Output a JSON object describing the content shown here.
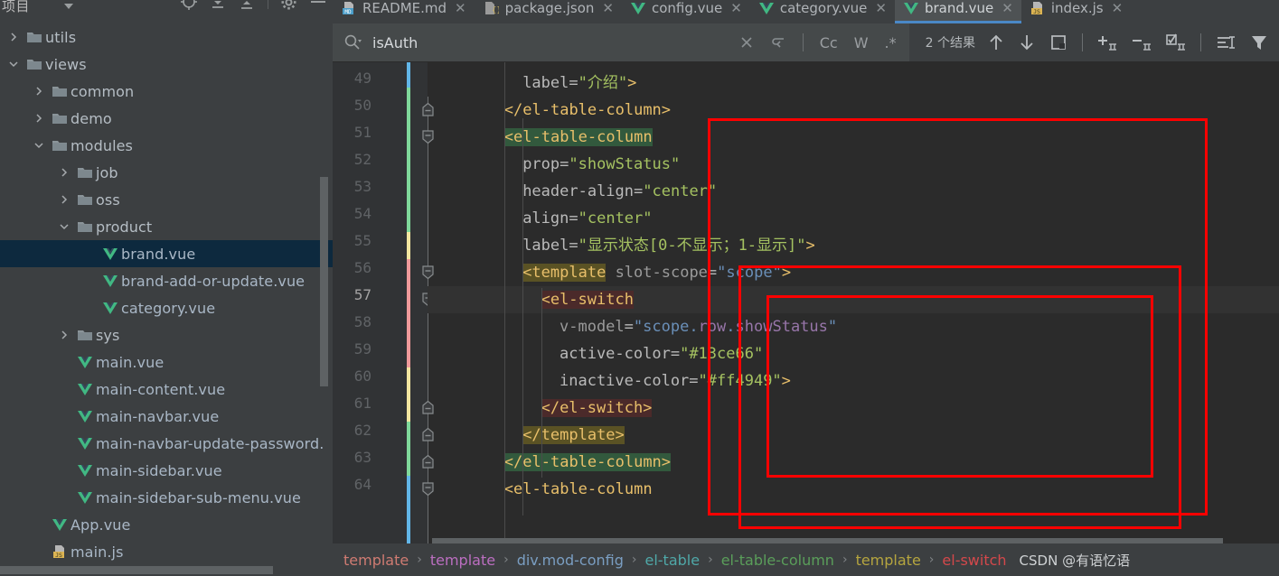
{
  "sidebar": {
    "title": "项目",
    "toolbar": [
      "locate-icon",
      "collapse-all-icon",
      "expand-icon",
      "settings-icon",
      "minimize-icon"
    ],
    "tree": [
      {
        "label": "utils",
        "type": "folder",
        "depth": 1,
        "state": "collapsed",
        "selected": false
      },
      {
        "label": "views",
        "type": "folder",
        "depth": 1,
        "state": "expanded",
        "selected": false
      },
      {
        "label": "common",
        "type": "folder",
        "depth": 2,
        "state": "collapsed",
        "selected": false
      },
      {
        "label": "demo",
        "type": "folder",
        "depth": 2,
        "state": "collapsed",
        "selected": false
      },
      {
        "label": "modules",
        "type": "folder",
        "depth": 2,
        "state": "expanded",
        "selected": false
      },
      {
        "label": "job",
        "type": "folder",
        "depth": 3,
        "state": "collapsed",
        "selected": false
      },
      {
        "label": "oss",
        "type": "folder",
        "depth": 3,
        "state": "collapsed",
        "selected": false
      },
      {
        "label": "product",
        "type": "folder",
        "depth": 3,
        "state": "expanded",
        "selected": false
      },
      {
        "label": "brand.vue",
        "type": "vue",
        "depth": 4,
        "state": "leaf",
        "selected": true
      },
      {
        "label": "brand-add-or-update.vue",
        "type": "vue",
        "depth": 4,
        "state": "leaf",
        "selected": false
      },
      {
        "label": "category.vue",
        "type": "vue",
        "depth": 4,
        "state": "leaf",
        "selected": false
      },
      {
        "label": "sys",
        "type": "folder",
        "depth": 3,
        "state": "collapsed",
        "selected": false
      },
      {
        "label": "main.vue",
        "type": "vue",
        "depth": 3,
        "state": "leaf",
        "selected": false
      },
      {
        "label": "main-content.vue",
        "type": "vue",
        "depth": 3,
        "state": "leaf",
        "selected": false
      },
      {
        "label": "main-navbar.vue",
        "type": "vue",
        "depth": 3,
        "state": "leaf",
        "selected": false
      },
      {
        "label": "main-navbar-update-password.",
        "type": "vue",
        "depth": 3,
        "state": "leaf",
        "selected": false
      },
      {
        "label": "main-sidebar.vue",
        "type": "vue",
        "depth": 3,
        "state": "leaf",
        "selected": false
      },
      {
        "label": "main-sidebar-sub-menu.vue",
        "type": "vue",
        "depth": 3,
        "state": "leaf",
        "selected": false
      },
      {
        "label": "App.vue",
        "type": "vue",
        "depth": 2,
        "state": "leaf",
        "selected": false
      },
      {
        "label": "main.js",
        "type": "js",
        "depth": 2,
        "state": "leaf",
        "selected": false
      }
    ]
  },
  "tabs": [
    {
      "label": "README.md",
      "icon": "markdown-icon",
      "active": false
    },
    {
      "label": "package.json",
      "icon": "json-icon",
      "active": false
    },
    {
      "label": "config.vue",
      "icon": "vue-icon",
      "active": false
    },
    {
      "label": "category.vue",
      "icon": "vue-icon",
      "active": false
    },
    {
      "label": "brand.vue",
      "icon": "vue-icon",
      "active": true
    },
    {
      "label": "index.js",
      "icon": "js-icon",
      "active": false
    }
  ],
  "search": {
    "value": "isAuth",
    "results_label": "2 个结果",
    "options": [
      {
        "label": "Cc",
        "name": "match-case-toggle"
      },
      {
        "label": "W",
        "name": "words-toggle"
      },
      {
        "label": ".*",
        "name": "regex-toggle"
      }
    ],
    "icons": [
      "search-icon",
      "clear-icon",
      "history-icon",
      "prev-match-icon",
      "next-match-icon",
      "select-all-icon",
      "add-caret-icon",
      "remove-caret-icon",
      "select-occurrences-icon",
      "toggle-lines-icon",
      "filter-icon"
    ]
  },
  "code": {
    "current_line": 57,
    "first_line": 49,
    "lines": [
      {
        "n": 49,
        "text": "      label=\"介绍\">"
      },
      {
        "n": 50,
        "text": "    </el-table-column>"
      },
      {
        "n": 51,
        "text": "    <el-table-column"
      },
      {
        "n": 52,
        "text": "      prop=\"showStatus\""
      },
      {
        "n": 53,
        "text": "      header-align=\"center\""
      },
      {
        "n": 54,
        "text": "      align=\"center\""
      },
      {
        "n": 55,
        "text": "      label=\"显示状态[0-不显示；1-显示]\">"
      },
      {
        "n": 56,
        "text": "      <template slot-scope=\"scope\">"
      },
      {
        "n": 57,
        "text": "        <el-switch"
      },
      {
        "n": 58,
        "text": "          v-model=\"scope.row.showStatus\""
      },
      {
        "n": 59,
        "text": "          active-color=\"#13ce66\""
      },
      {
        "n": 60,
        "text": "          inactive-color=\"#ff4949\">"
      },
      {
        "n": 61,
        "text": "        </el-switch>"
      },
      {
        "n": 62,
        "text": "      </template>"
      },
      {
        "n": 63,
        "text": "    </el-table-column>"
      },
      {
        "n": 64,
        "text": "    <el-table-column"
      }
    ]
  },
  "breadcrumb": {
    "items": [
      {
        "label": "template",
        "color": "#cf7b72"
      },
      {
        "label": "template",
        "color": "#bb6ec0"
      },
      {
        "label": "div.mod-config",
        "color": "#7a9ec2"
      },
      {
        "label": "el-table",
        "color": "#4fa8a8"
      },
      {
        "label": "el-table-column",
        "color": "#5a9e5a"
      },
      {
        "label": "template",
        "color": "#b5a53f"
      },
      {
        "label": "el-switch",
        "color": "#d4484b"
      }
    ],
    "separator": "›"
  },
  "watermark": "CSDN @有语忆语",
  "annotations": {
    "accent_color": "#ff0000",
    "boxes": [
      {
        "name": "outer-el-table-column-box"
      },
      {
        "name": "template-block-box"
      },
      {
        "name": "el-switch-box"
      }
    ]
  }
}
